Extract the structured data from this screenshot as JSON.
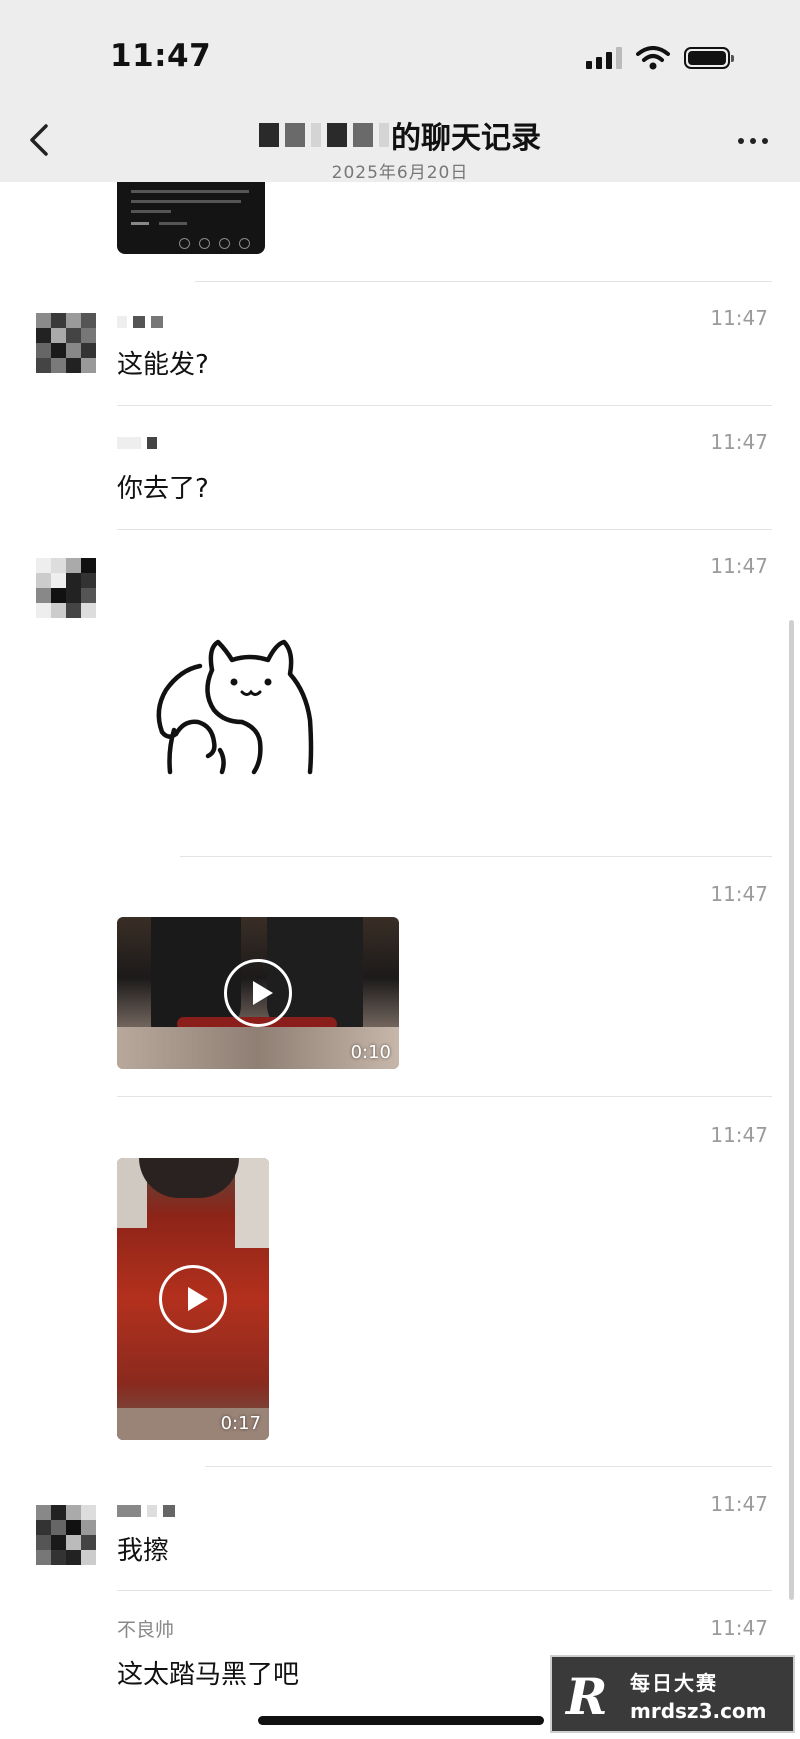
{
  "status_bar": {
    "time": "11:47"
  },
  "header": {
    "title": "的聊天记录",
    "subtitle": "2025年6月20日"
  },
  "messages": [
    {
      "time": "11:47",
      "text": "这能发?"
    },
    {
      "time": "11:47",
      "text": "你去了?"
    },
    {
      "time": "11:47",
      "type": "sticker"
    },
    {
      "time": "11:47",
      "type": "video",
      "duration": "0:10"
    },
    {
      "time": "11:47",
      "type": "video",
      "duration": "0:17"
    },
    {
      "time": "11:47",
      "text": "我擦"
    },
    {
      "time": "11:47",
      "sender": "不良帅",
      "text": "这太踏马黑了吧"
    }
  ],
  "watermark": {
    "logo": "R",
    "title": "每日大赛",
    "url": "mrdsz3.com"
  }
}
